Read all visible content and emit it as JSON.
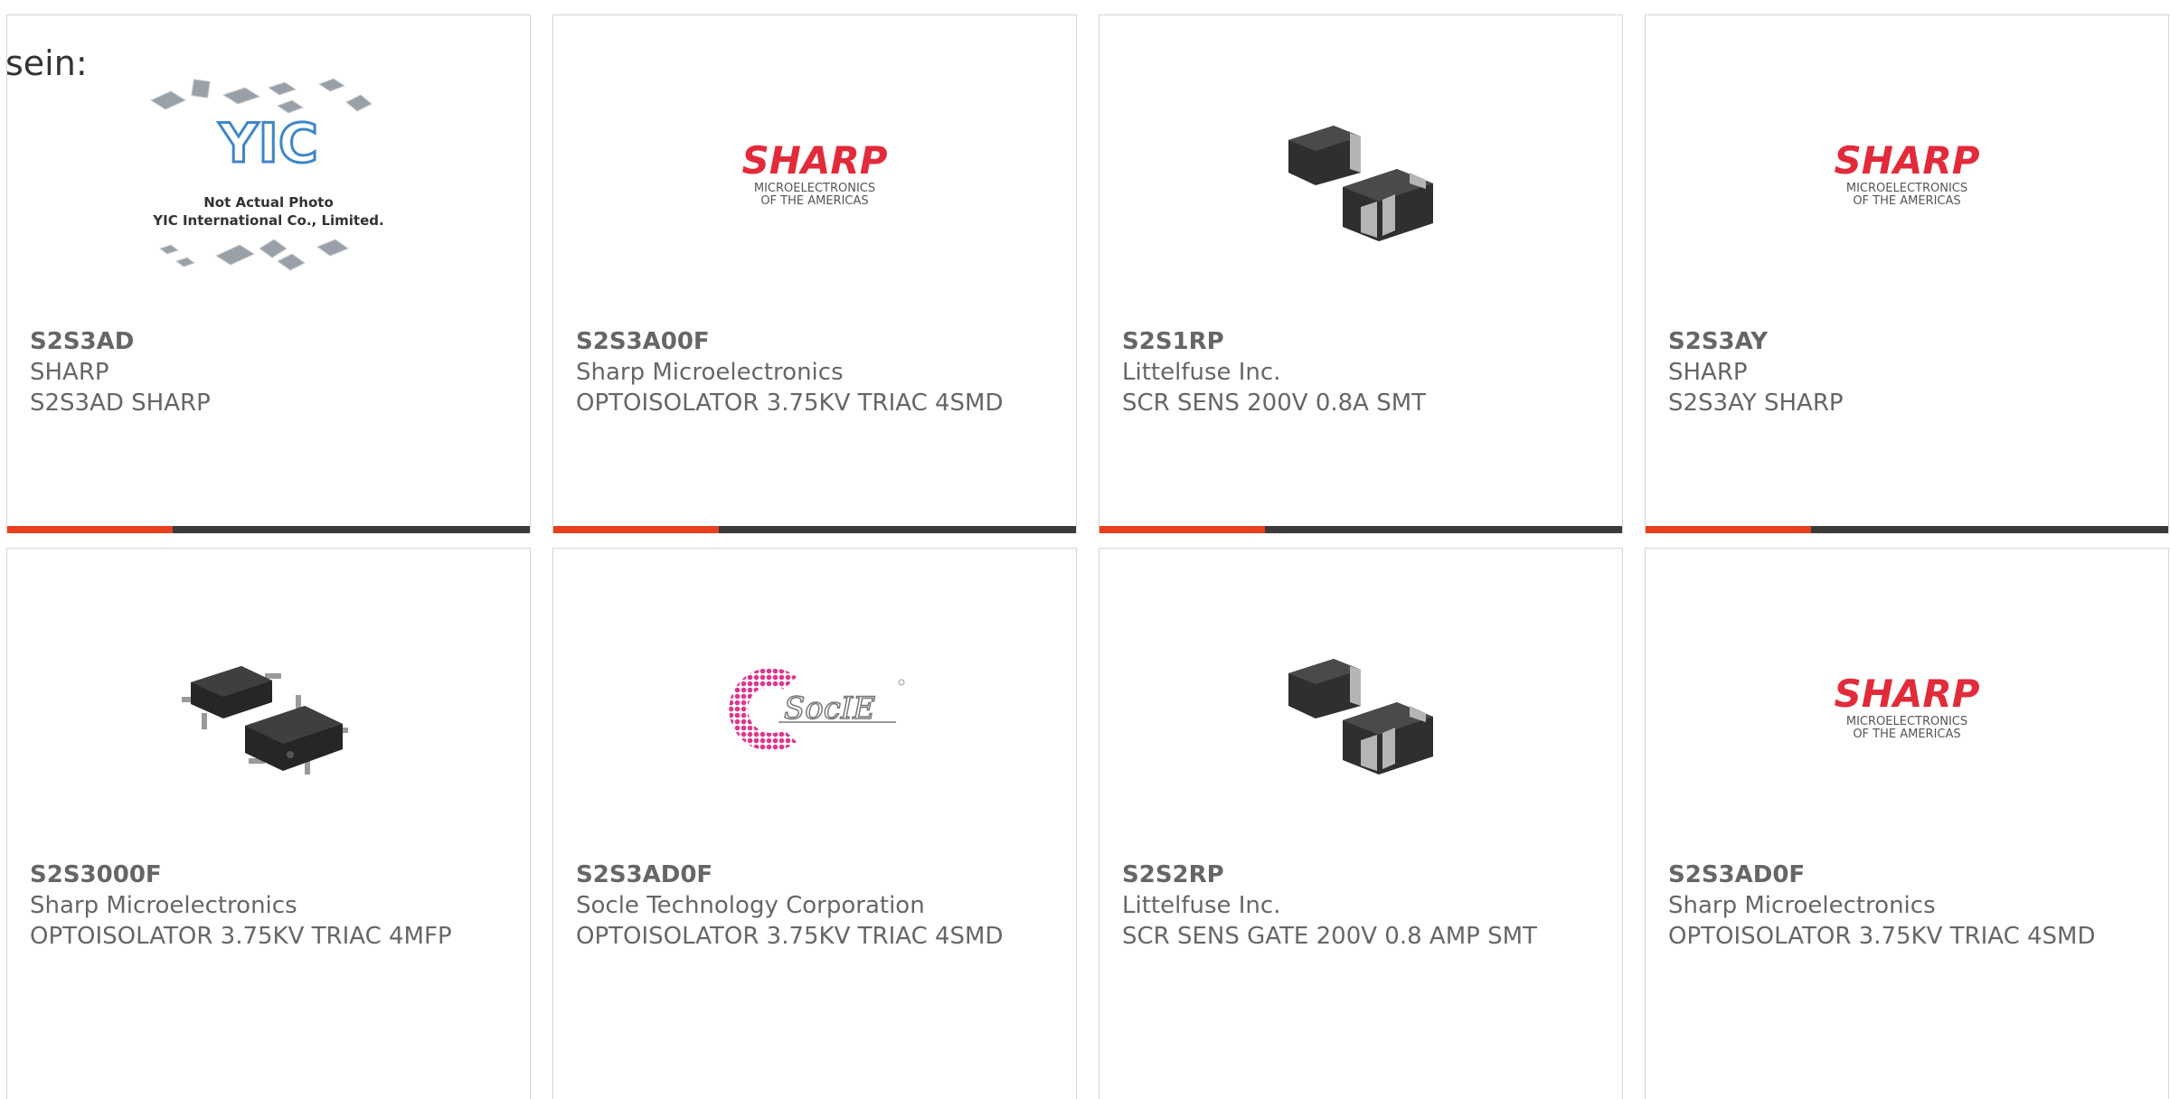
{
  "lead_text": "sein:",
  "accent_color": "#e8401c",
  "bar_color": "#3a3a3a",
  "placeholder": {
    "line1": "Not Actual Photo",
    "line2": "YIC International Co., Limited.",
    "logo": "YIC"
  },
  "sharp_logo": {
    "name": "SHARP",
    "line1": "MICROELECTRONICS",
    "line2": "OF THE AMERICAS"
  },
  "socle_logo": {
    "name": "SocIE"
  },
  "products": [
    {
      "part": "S2S3AD",
      "manufacturer": "SHARP",
      "description": "S2S3AD SHARP",
      "image": "yic-placeholder"
    },
    {
      "part": "S2S3A00F",
      "manufacturer": "Sharp Microelectronics",
      "description": "OPTOISOLATOR 3.75KV TRIAC 4SMD",
      "image": "sharp-logo"
    },
    {
      "part": "S2S1RP",
      "manufacturer": "Littelfuse Inc.",
      "description": "SCR SENS 200V 0.8A SMT",
      "image": "smd-package-photo"
    },
    {
      "part": "S2S3AY",
      "manufacturer": "SHARP",
      "description": "S2S3AY SHARP",
      "image": "sharp-logo"
    },
    {
      "part": "S2S3000F",
      "manufacturer": "Sharp Microelectronics",
      "description": "OPTOISOLATOR 3.75KV TRIAC 4MFP",
      "image": "sop-package-photo"
    },
    {
      "part": "S2S3AD0F",
      "manufacturer": "Socle Technology Corporation",
      "description": "OPTOISOLATOR 3.75KV TRIAC 4SMD",
      "image": "socle-logo"
    },
    {
      "part": "S2S2RP",
      "manufacturer": "Littelfuse Inc.",
      "description": "SCR SENS GATE 200V 0.8 AMP SMT",
      "image": "smd-package-photo"
    },
    {
      "part": "S2S3AD0F",
      "manufacturer": "Sharp Microelectronics",
      "description": "OPTOISOLATOR 3.75KV TRIAC 4SMD",
      "image": "sharp-logo"
    }
  ]
}
